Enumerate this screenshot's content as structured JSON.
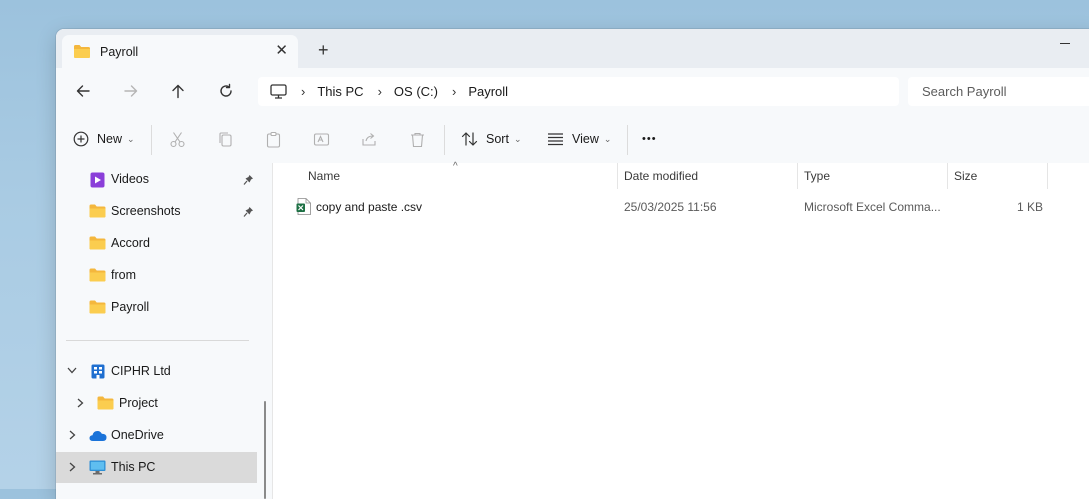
{
  "window": {
    "tab_title": "Payroll",
    "tab_close": "✕",
    "new_tab": "+"
  },
  "nav": {
    "breadcrumbs": [
      "This PC",
      "OS (C:)",
      "Payroll"
    ],
    "separator": "›",
    "search_placeholder": "Search Payroll"
  },
  "toolbar": {
    "new_label": "New",
    "sort_label": "Sort",
    "view_label": "View",
    "more_label": "•••",
    "chevron": "⌄"
  },
  "sidebar": {
    "quick_access": [
      {
        "label": "Videos",
        "icon": "videos-folder-icon",
        "pinned": true
      },
      {
        "label": "Screenshots",
        "icon": "folder-icon",
        "pinned": true
      },
      {
        "label": "Accord",
        "icon": "folder-icon",
        "pinned": false
      },
      {
        "label": "from",
        "icon": "folder-icon",
        "pinned": false
      },
      {
        "label": "Payroll",
        "icon": "folder-icon",
        "pinned": false
      }
    ],
    "tree": [
      {
        "label": "CIPHR Ltd",
        "icon": "organization-icon",
        "expanded": true
      },
      {
        "label": "Project",
        "icon": "folder-icon",
        "expanded": false
      },
      {
        "label": "OneDrive",
        "icon": "onedrive-icon",
        "expanded": false
      },
      {
        "label": "This PC",
        "icon": "this-pc-icon",
        "expanded": false,
        "selected": true
      }
    ]
  },
  "file_list": {
    "columns": [
      "Name",
      "Date modified",
      "Type",
      "Size"
    ],
    "sort_indicator": "^",
    "files": [
      {
        "name": "copy and paste .csv",
        "date_modified": "25/03/2025 11:56",
        "type": "Microsoft Excel Comma...",
        "size": "1 KB",
        "icon": "excel-csv-icon"
      }
    ]
  },
  "colors": {
    "folder_yellow": "#f6c344",
    "accent_blue": "#0078d4",
    "selection_gray": "#dadada",
    "excel_green": "#1d7044"
  }
}
